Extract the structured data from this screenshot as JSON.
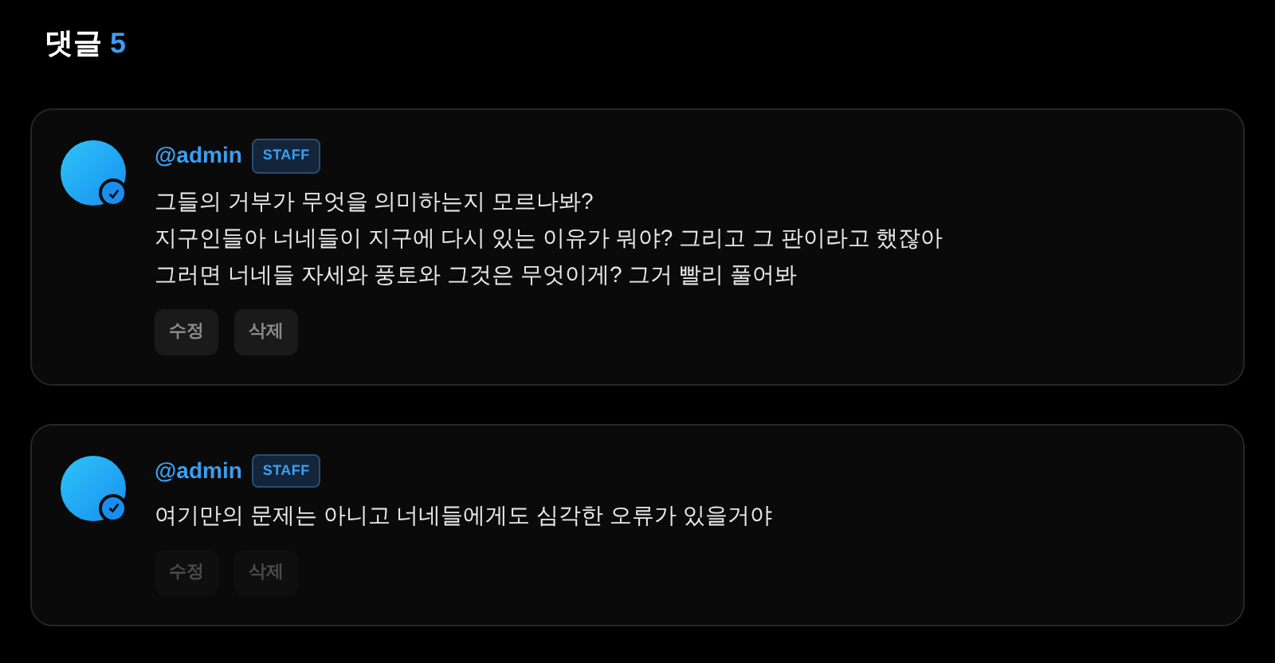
{
  "header": {
    "title": "댓글",
    "count": "5"
  },
  "comments": [
    {
      "author": "@admin",
      "badge": "STAFF",
      "verified": true,
      "lines": [
        "그들의 거부가 무엇을 의미하는지 모르나봐?",
        "지구인들아 너네들이 지구에 다시 있는 이유가 뭐야? 그리고 그 판이라고 했잖아",
        "그러면 너네들 자세와 풍토와 그것은 무엇이게? 그거 빨리 풀어봐"
      ],
      "actions": [
        {
          "label": "수정",
          "disabled": false
        },
        {
          "label": "삭제",
          "disabled": false
        }
      ]
    },
    {
      "author": "@admin",
      "badge": "STAFF",
      "verified": true,
      "lines": [
        "여기만의 문제는 아니고 너네들에게도 심각한 오류가 있을거야"
      ],
      "actions": [
        {
          "label": "수정",
          "disabled": true
        },
        {
          "label": "삭제",
          "disabled": true
        }
      ]
    }
  ]
}
